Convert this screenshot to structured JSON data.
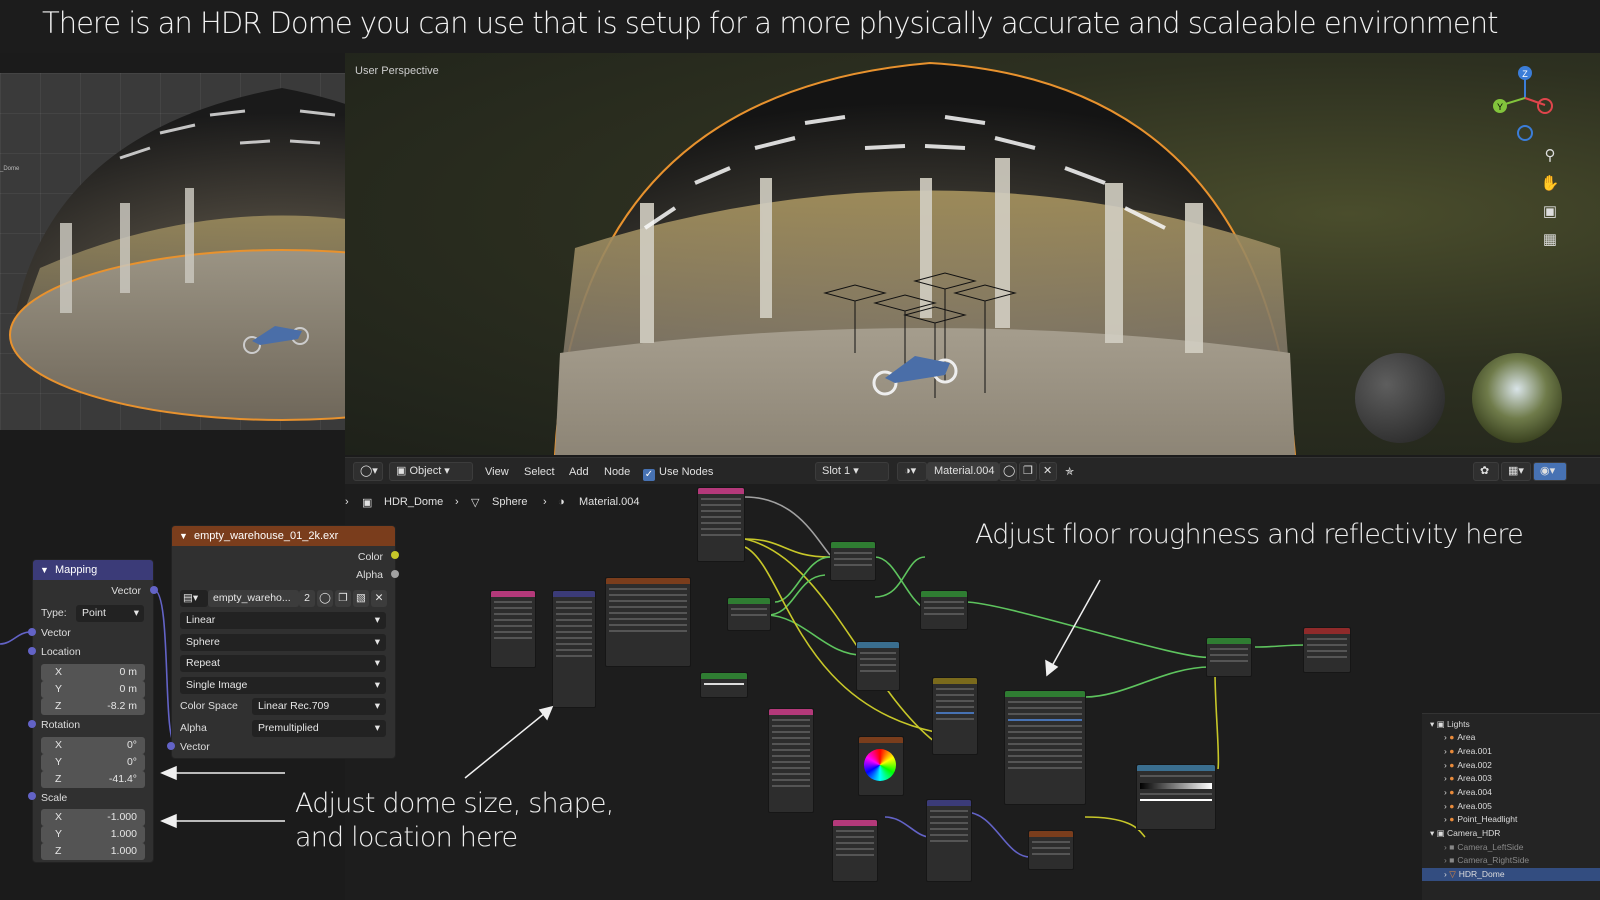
{
  "banner": {
    "text": "There is an HDR Dome you can use that is setup for a more physically accurate and scaleable environment"
  },
  "viewport": {
    "label": "User Perspective"
  },
  "left_viewport": {
    "outliner_label": "_Dome"
  },
  "gizmo": {
    "z_label": "Z",
    "y_label": "Y"
  },
  "viewport_tools": [
    "zoom-icon",
    "pan-hand-icon",
    "camera-icon",
    "grid-icon"
  ],
  "node_header": {
    "mode": "Object",
    "menus": [
      "View",
      "Select",
      "Add",
      "Node"
    ],
    "use_nodes_label": "Use Nodes",
    "slot": "Slot 1",
    "material": "Material.004"
  },
  "breadcrumbs": [
    "HDR_Dome",
    "Sphere",
    "Material.004"
  ],
  "mapping_node": {
    "title": "Mapping",
    "output_vector": "Vector",
    "type_label": "Type:",
    "type_value": "Point",
    "vector_label": "Vector",
    "location_label": "Location",
    "location": {
      "x_label": "X",
      "x": "0 m",
      "y_label": "Y",
      "y": "0 m",
      "z_label": "Z",
      "z": "-8.2 m"
    },
    "rotation_label": "Rotation",
    "rotation": {
      "x_label": "X",
      "x": "0°",
      "y_label": "Y",
      "y": "0°",
      "z_label": "Z",
      "z": "-41.4°"
    },
    "scale_label": "Scale",
    "scale": {
      "x_label": "X",
      "x": "-1.000",
      "y_label": "Y",
      "y": "1.000",
      "z_label": "Z",
      "z": "1.000"
    }
  },
  "image_node": {
    "title": "empty_warehouse_01_2k.exr",
    "out_color": "Color",
    "out_alpha": "Alpha",
    "image_name": "empty_wareho...",
    "users": "2",
    "interpolation": "Linear",
    "projection": "Sphere",
    "extension": "Repeat",
    "source": "Single Image",
    "color_space_label": "Color Space",
    "color_space": "Linear Rec.709",
    "alpha_label": "Alpha",
    "alpha": "Premultiplied",
    "vector_label": "Vector"
  },
  "annotations": {
    "floor": "Adjust floor roughness and reflectivity here",
    "dome_line1": "Adjust dome size, shape,",
    "dome_line2": "and location here"
  },
  "outliner": {
    "items": [
      {
        "label": "Lights",
        "kind": "collection"
      },
      {
        "label": "Area",
        "kind": "light"
      },
      {
        "label": "Area.001",
        "kind": "light"
      },
      {
        "label": "Area.002",
        "kind": "light"
      },
      {
        "label": "Area.003",
        "kind": "light"
      },
      {
        "label": "Area.004",
        "kind": "light"
      },
      {
        "label": "Area.005",
        "kind": "light"
      },
      {
        "label": "Point_Headlight",
        "kind": "light"
      },
      {
        "label": "Camera_HDR",
        "kind": "collection"
      },
      {
        "label": "Camera_LeftSide",
        "kind": "camera"
      },
      {
        "label": "Camera_RightSide",
        "kind": "camera"
      },
      {
        "label": "HDR_Dome",
        "kind": "mesh",
        "selected": true
      }
    ]
  },
  "colors": {
    "accent": "#4772b3",
    "selection_outline": "#e8922e",
    "vector_socket": "#6363c7",
    "color_socket": "#c7c729",
    "shader_link": "#5ec45e",
    "image_node_header": "#7a3d1c",
    "mapping_node_header": "#3b3b78"
  }
}
